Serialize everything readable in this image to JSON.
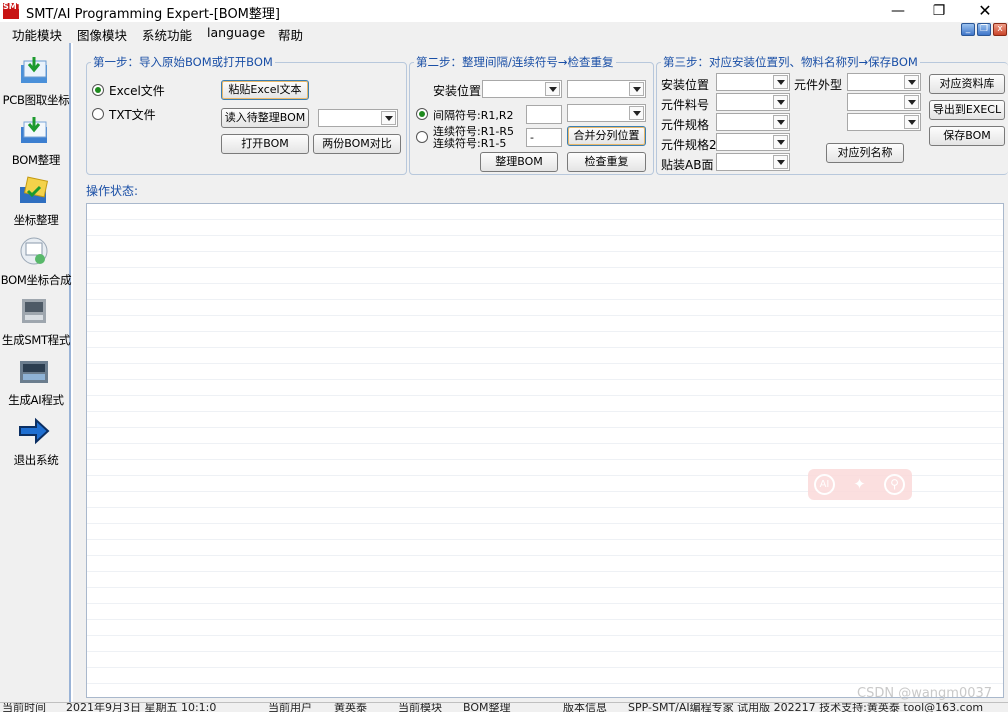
{
  "window": {
    "title": "SMT/AI Programming Expert-[BOM整理]",
    "icon_text": "SMT"
  },
  "menu": [
    "功能模块",
    "图像模块",
    "系统功能",
    "language",
    "帮助"
  ],
  "sidebar": [
    {
      "label": "PCB图取坐标",
      "icon": "pcb-coordinate-icon"
    },
    {
      "label": "BOM整理",
      "icon": "bom-organize-icon"
    },
    {
      "label": "坐标整理",
      "icon": "coordinate-organize-icon"
    },
    {
      "label": "BOM坐标合成",
      "icon": "bom-merge-icon"
    },
    {
      "label": "生成SMT程式",
      "icon": "smt-machine-icon"
    },
    {
      "label": "生成AI程式",
      "icon": "ai-machine-icon"
    },
    {
      "label": "退出系统",
      "icon": "exit-arrow-icon"
    }
  ],
  "step1": {
    "legend": "第一步：导入原始BOM或打开BOM",
    "radio_excel": "Excel文件",
    "radio_txt": "TXT文件",
    "btn_paste": "粘贴Excel文本",
    "btn_read": "读入待整理BOM",
    "btn_open": "打开BOM",
    "btn_compare": "两份BOM对比"
  },
  "step2": {
    "legend": "第二步：整理间隔/连续符号→检查重复",
    "lbl_location": "安装位置",
    "radio_interval": "间隔符号:R1,R2",
    "radio_cont1": "连续符号:R1-R5",
    "radio_cont2": "连续符号:R1-5",
    "dash_value": "-",
    "btn_merge": "合并分列位置",
    "btn_organize": "整理BOM",
    "btn_check": "检查重复"
  },
  "step3": {
    "legend": "第三步：对应安装位置列、物料名称列→保存BOM",
    "lbl_location": "安装位置",
    "lbl_partno": "元件料号",
    "lbl_spec": "元件规格",
    "lbl_spec2": "元件规格2",
    "lbl_side": "贴装AB面",
    "lbl_package": "元件外型",
    "btn_library": "对应资料库",
    "btn_export": "导出到EXECL",
    "btn_save": "保存BOM",
    "btn_colname": "对应列名称"
  },
  "status_label": "操作状态:",
  "statusbar": [
    "当前时间",
    "2021年9月3日  星期五  10:1:0",
    "当前用户",
    "黄英泰",
    "当前模块",
    "BOM整理",
    "版本信息",
    "SPP-SMT/AI编程专家 试用版 202217  技术支持:黄英泰 tool@163.com"
  ],
  "watermark": "CSDN @wangm0037",
  "colors": {
    "accent": "#1a4fa6",
    "sidebar_border": "#9ab3d6",
    "badge": "#fbdada"
  }
}
